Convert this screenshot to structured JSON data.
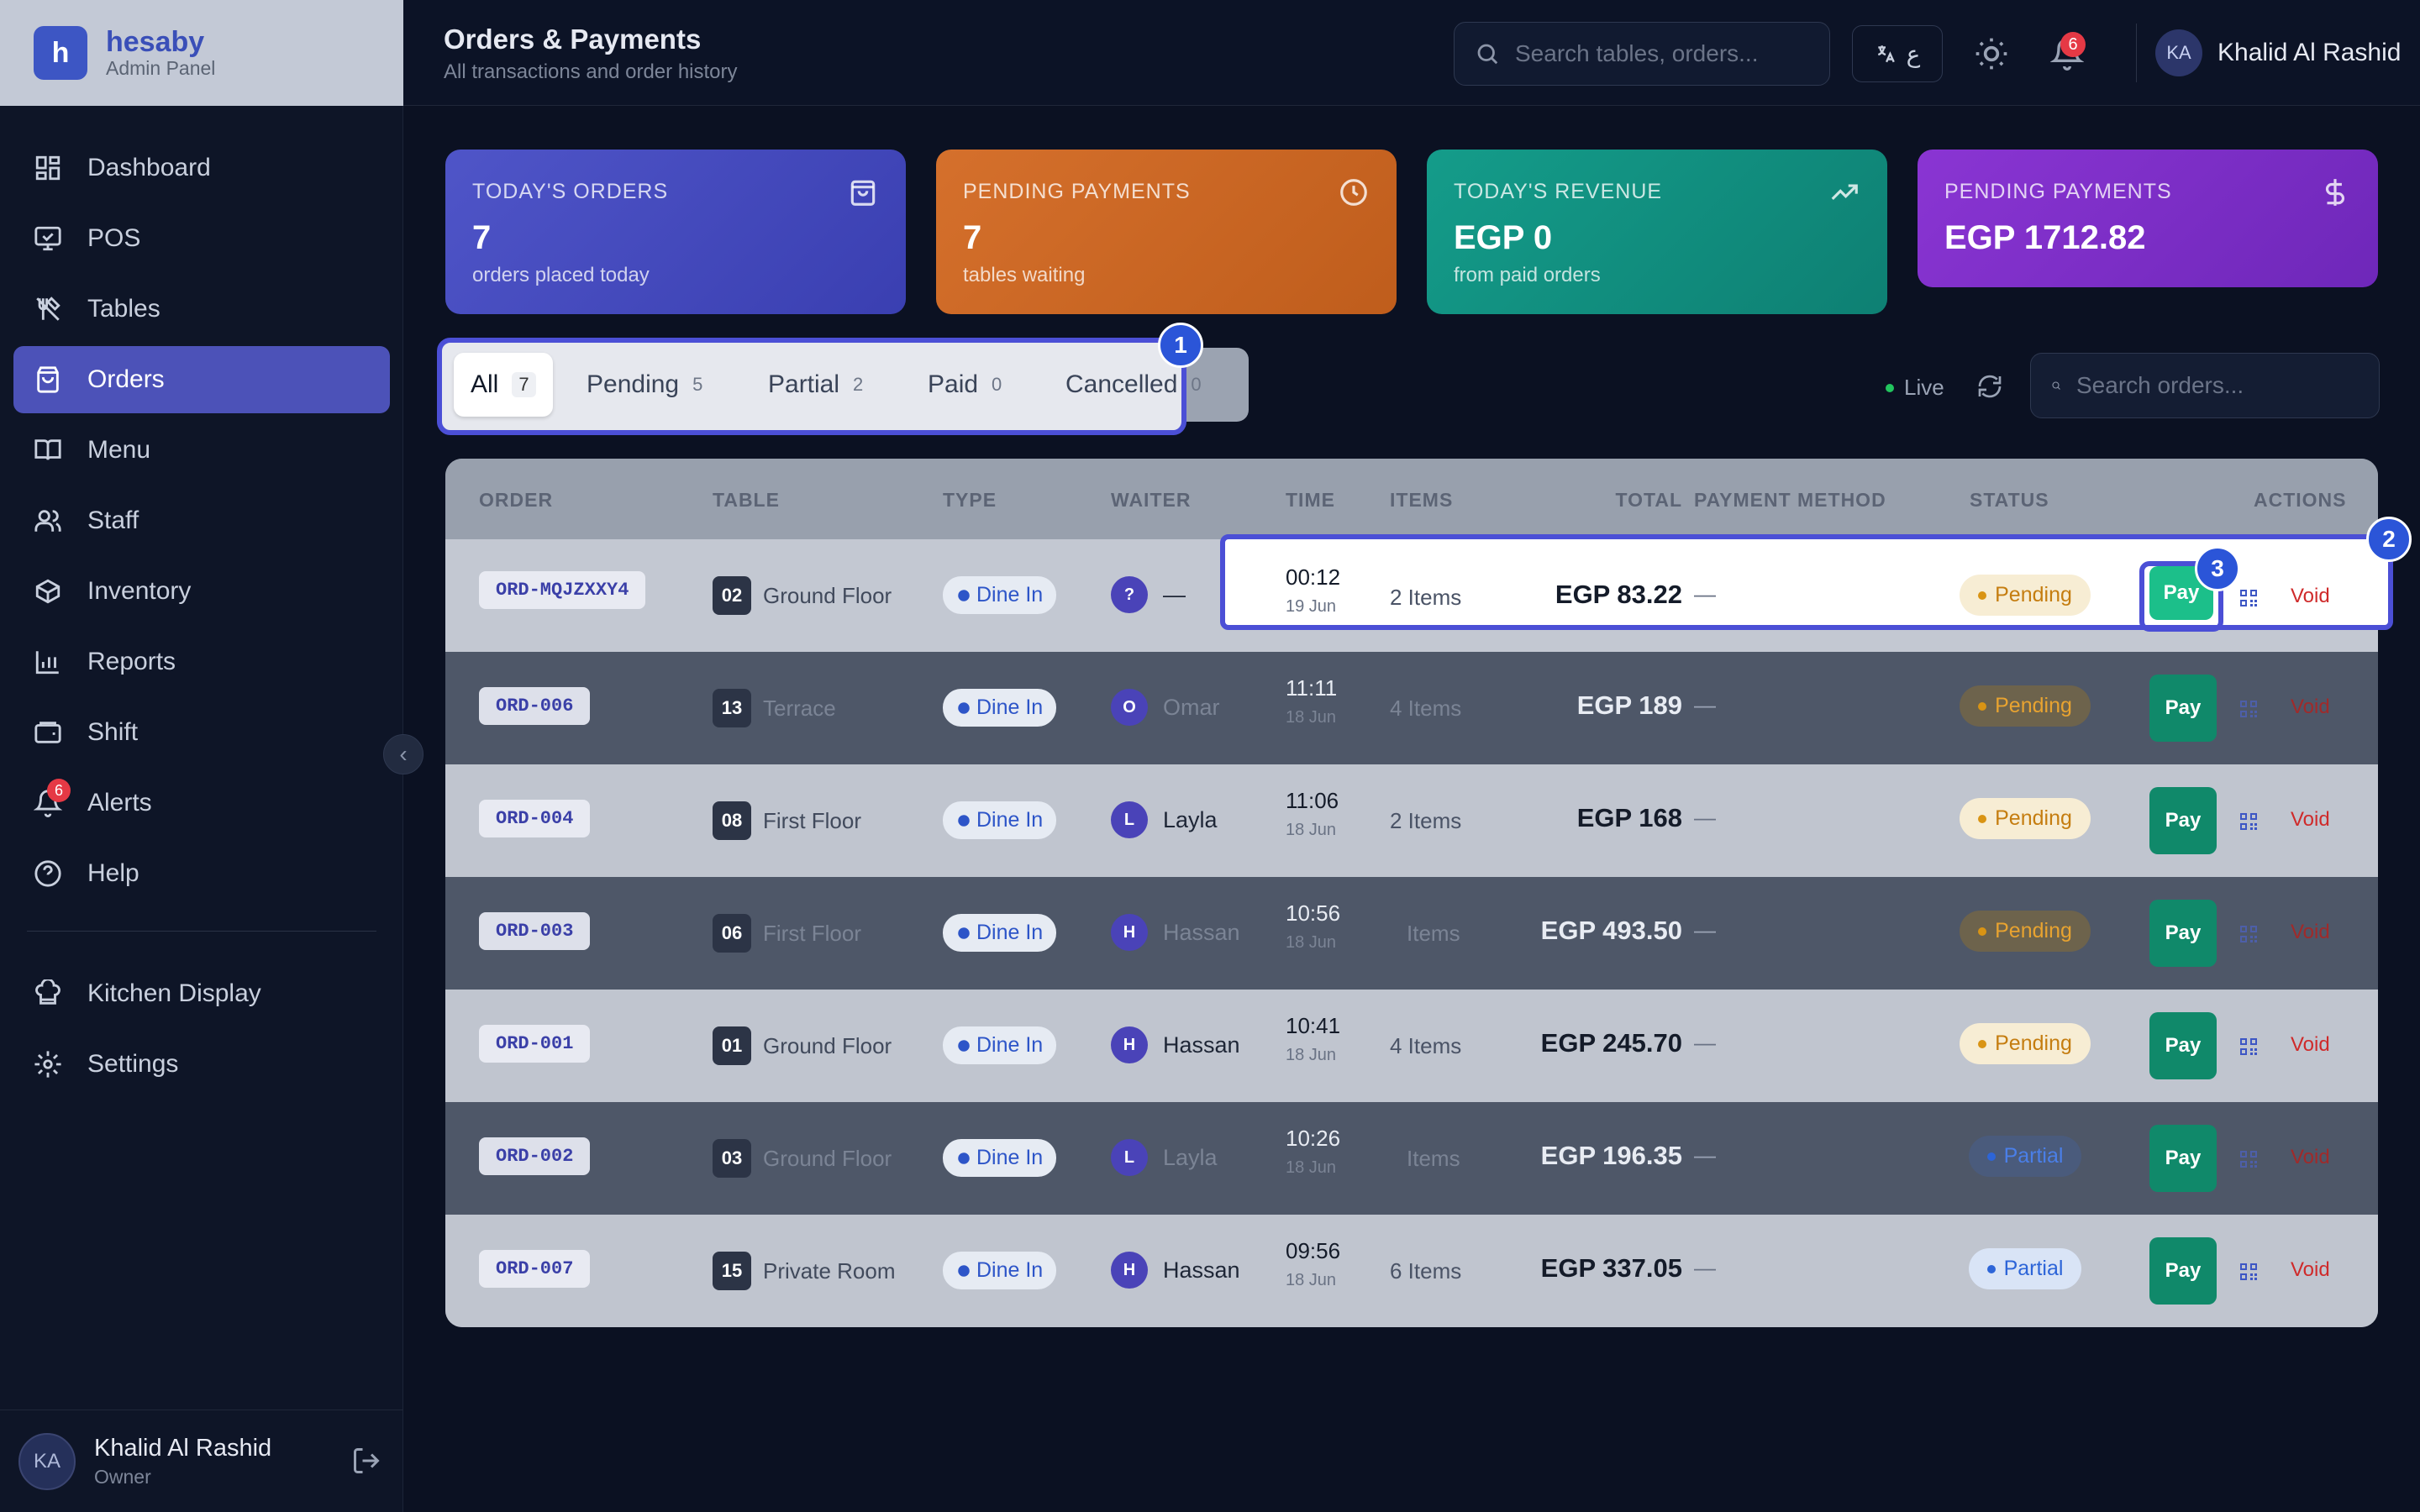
{
  "brand": {
    "logo_letter": "h",
    "name": "hesaby",
    "subtitle": "Admin Panel"
  },
  "sidebar": {
    "items": [
      {
        "label": "Dashboard",
        "icon": "dashboard-icon"
      },
      {
        "label": "POS",
        "icon": "monitor-icon"
      },
      {
        "label": "Tables",
        "icon": "utensils-icon"
      },
      {
        "label": "Orders",
        "icon": "shopping-bag-icon",
        "active": true
      },
      {
        "label": "Menu",
        "icon": "book-icon"
      },
      {
        "label": "Staff",
        "icon": "users-icon"
      },
      {
        "label": "Inventory",
        "icon": "box-icon"
      },
      {
        "label": "Reports",
        "icon": "bar-chart-icon"
      },
      {
        "label": "Shift",
        "icon": "wallet-icon"
      },
      {
        "label": "Alerts",
        "icon": "bell-icon",
        "badge": "6"
      },
      {
        "label": "Help",
        "icon": "help-circle-icon"
      }
    ],
    "secondary": [
      {
        "label": "Kitchen Display",
        "icon": "chef-hat-icon"
      },
      {
        "label": "Settings",
        "icon": "gear-icon"
      }
    ],
    "user": {
      "initials": "KA",
      "name": "Khalid Al Rashid",
      "role": "Owner"
    }
  },
  "header": {
    "title": "Orders & Payments",
    "subtitle": "All transactions and order history",
    "search_placeholder": "Search tables, orders...",
    "lang_label": "ع",
    "notifications": "6",
    "user": {
      "initials": "KA",
      "name": "Khalid Al Rashid"
    }
  },
  "stats": [
    {
      "label": "TODAY'S ORDERS",
      "value": "7",
      "sub": "orders placed today",
      "icon": "shopping-bag-icon"
    },
    {
      "label": "PENDING PAYMENTS",
      "value": "7",
      "sub": "tables waiting",
      "icon": "clock-icon"
    },
    {
      "label": "TODAY'S REVENUE",
      "value": "EGP 0",
      "sub": "from paid orders",
      "icon": "trending-up-icon"
    },
    {
      "label": "PENDING PAYMENTS",
      "value": "EGP 1712.82",
      "sub": "",
      "icon": "dollar-icon"
    }
  ],
  "filters": [
    {
      "label": "All",
      "count": "7",
      "active": true
    },
    {
      "label": "Pending",
      "count": "5"
    },
    {
      "label": "Partial",
      "count": "2"
    },
    {
      "label": "Paid",
      "count": "0"
    },
    {
      "label": "Cancelled",
      "count": "0"
    }
  ],
  "live_label": "Live",
  "orders_search_placeholder": "Search orders...",
  "table": {
    "headers": [
      "ORDER",
      "TABLE",
      "TYPE",
      "WAITER",
      "TIME",
      "ITEMS",
      "TOTAL",
      "PAYMENT METHOD",
      "STATUS",
      "ACTIONS"
    ],
    "rows": [
      {
        "id": "ORD-MQJZXXY4",
        "table_no": "02",
        "area": "Ground Floor",
        "type": "Dine In",
        "waiter_initial": "?",
        "waiter": "—",
        "time": "00:12",
        "date": "19 Jun",
        "items": "2 Items",
        "total": "EGP 83.22",
        "payment": "—",
        "status": "Pending"
      },
      {
        "id": "ORD-006",
        "table_no": "13",
        "area": "Terrace",
        "type": "Dine In",
        "waiter_initial": "O",
        "waiter": "Omar",
        "time": "11:11",
        "date": "18 Jun",
        "items": "4 Items",
        "total": "EGP 189",
        "payment": "—",
        "status": "Pending"
      },
      {
        "id": "ORD-004",
        "table_no": "08",
        "area": "First Floor",
        "type": "Dine In",
        "waiter_initial": "L",
        "waiter": "Layla",
        "time": "11:06",
        "date": "18 Jun",
        "items": "2 Items",
        "total": "EGP 168",
        "payment": "—",
        "status": "Pending"
      },
      {
        "id": "ORD-003",
        "table_no": "06",
        "area": "First Floor",
        "type": "Dine In",
        "waiter_initial": "H",
        "waiter": "Hassan",
        "time": "10:56",
        "date": "18 Jun",
        "items": "Items",
        "total": "EGP 493.50",
        "payment": "—",
        "status": "Pending"
      },
      {
        "id": "ORD-001",
        "table_no": "01",
        "area": "Ground Floor",
        "type": "Dine In",
        "waiter_initial": "H",
        "waiter": "Hassan",
        "time": "10:41",
        "date": "18 Jun",
        "items": "4 Items",
        "total": "EGP 245.70",
        "payment": "—",
        "status": "Pending"
      },
      {
        "id": "ORD-002",
        "table_no": "03",
        "area": "Ground Floor",
        "type": "Dine In",
        "waiter_initial": "L",
        "waiter": "Layla",
        "time": "10:26",
        "date": "18 Jun",
        "items": "Items",
        "total": "EGP 196.35",
        "payment": "—",
        "status": "Partial"
      },
      {
        "id": "ORD-007",
        "table_no": "15",
        "area": "Private Room",
        "type": "Dine In",
        "waiter_initial": "H",
        "waiter": "Hassan",
        "time": "09:56",
        "date": "18 Jun",
        "items": "6 Items",
        "total": "EGP 337.05",
        "payment": "—",
        "status": "Partial"
      }
    ],
    "pay_label": "Pay",
    "void_label": "Void"
  },
  "markers": [
    "1",
    "2",
    "3"
  ]
}
